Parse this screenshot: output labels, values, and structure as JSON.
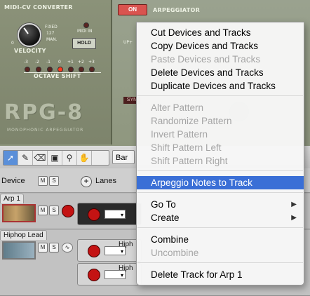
{
  "device": {
    "midi_cv_label": "MIDI-CV CONVERTER",
    "fixed_label": "FIXED",
    "fixed_value": "127",
    "man_label": "MAN.",
    "zero_label": "0",
    "velocity_label": "VELOCITY",
    "midi_in_label": "MIDI IN",
    "hold_label": "HOLD",
    "octave_values": [
      "-3",
      "-2",
      "-1",
      "0",
      "+1",
      "+2",
      "+3"
    ],
    "octave_shift_label": "OCTAVE SHIFT",
    "logo": "RPG-8",
    "logo_sub": "MONOPHONIC ARPEGGIATOR",
    "on_label": "ON",
    "arpeggiator_label": "ARPEGGIATOR",
    "sync_label": "SYN",
    "up_label": "UP+"
  },
  "toolbar": {
    "tools": [
      "arrow-tool-icon",
      "pencil-tool-icon",
      "eraser-tool-icon",
      "razor-tool-icon",
      "magnify-tool-icon",
      "hand-tool-icon"
    ],
    "snap_value": "Bar"
  },
  "track_header": {
    "device_label": "Device",
    "m_label": "M",
    "s_label": "S",
    "lanes_label": "Lanes",
    "add_label": "+"
  },
  "tracks": [
    {
      "name": "Arp 1",
      "m": "M",
      "s": "S"
    },
    {
      "name": "Hiphop Lead",
      "m": "M",
      "s": "S",
      "lane1": "Hiph",
      "lane2": "Hiph"
    }
  ],
  "context_menu": {
    "items": [
      {
        "label": "Cut Devices and Tracks",
        "enabled": true
      },
      {
        "label": "Copy Devices and Tracks",
        "enabled": true
      },
      {
        "label": "Paste Devices and Tracks",
        "enabled": false
      },
      {
        "label": "Delete Devices and Tracks",
        "enabled": true
      },
      {
        "label": "Duplicate Devices and Tracks",
        "enabled": true
      },
      {
        "label": "Alter Pattern",
        "enabled": false
      },
      {
        "label": "Randomize Pattern",
        "enabled": false
      },
      {
        "label": "Invert Pattern",
        "enabled": false
      },
      {
        "label": "Shift Pattern Left",
        "enabled": false
      },
      {
        "label": "Shift Pattern Right",
        "enabled": false
      },
      {
        "label": "Arpeggio Notes to Track",
        "enabled": true,
        "highlighted": true
      },
      {
        "label": "Go To",
        "enabled": true,
        "submenu": true
      },
      {
        "label": "Create",
        "enabled": true,
        "submenu": true
      },
      {
        "label": "Combine",
        "enabled": true
      },
      {
        "label": "Uncombine",
        "enabled": false
      },
      {
        "label": "Delete Track for Arp 1",
        "enabled": true
      }
    ],
    "submenu_arrow": "▶"
  }
}
